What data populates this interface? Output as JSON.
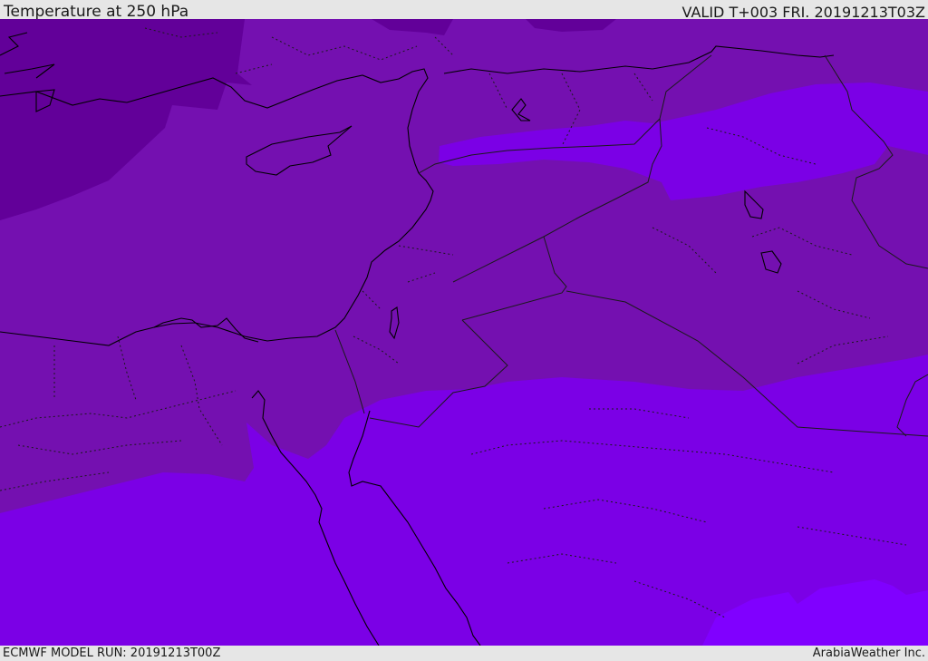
{
  "header": {
    "title": "Temperature at 250 hPa",
    "valid": "VALID T+003 FRI. 20191213T03Z"
  },
  "footer": {
    "model_run": "ECMWF MODEL RUN: 20191213T00Z",
    "provider": "ArabiaWeather Inc."
  },
  "map": {
    "field": "temperature",
    "level_hpa": 250,
    "fill_colors": {
      "coldest": "#620099",
      "cold": "#7410b0",
      "mid": "#7a00d8",
      "warm": "#7b00e6",
      "warmest": "#8000ff"
    },
    "coastline_color": "#000000",
    "border_color": "#1a1a1a"
  }
}
